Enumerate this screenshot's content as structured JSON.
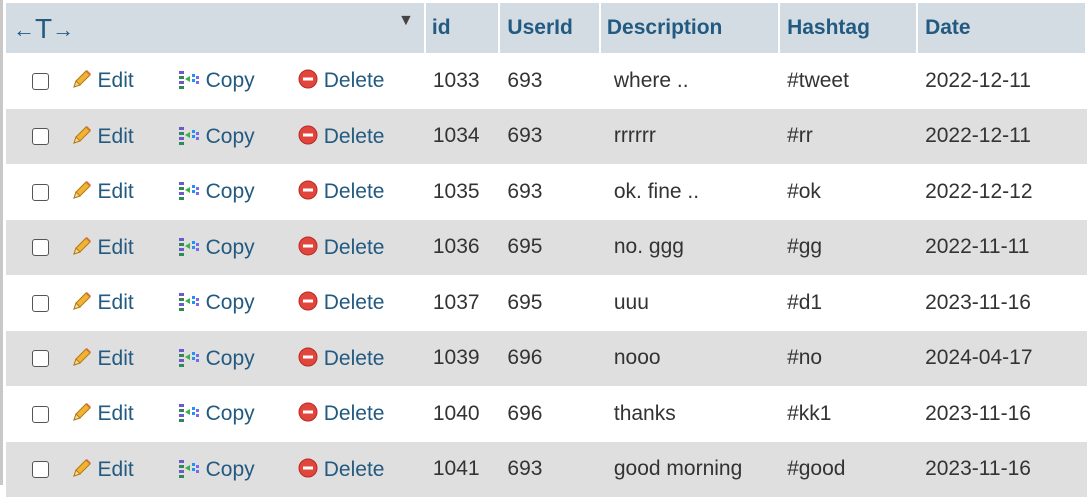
{
  "header": {
    "nav_left": "←",
    "nav_bar": "T",
    "nav_right": "→",
    "sort_indicator": "▼",
    "columns": [
      "id",
      "UserId",
      "Description",
      "Hashtag",
      "Date"
    ]
  },
  "actions": {
    "edit": "Edit",
    "copy": "Copy",
    "delete": "Delete"
  },
  "rows": [
    {
      "id": "1033",
      "userid": "693",
      "description": "where ..",
      "hashtag": "#tweet",
      "date": "2022-12-11"
    },
    {
      "id": "1034",
      "userid": "693",
      "description": "rrrrrr",
      "hashtag": "#rr",
      "date": "2022-12-11"
    },
    {
      "id": "1035",
      "userid": "693",
      "description": "ok. fine ..",
      "hashtag": "#ok",
      "date": "2022-12-12"
    },
    {
      "id": "1036",
      "userid": "695",
      "description": "no. ggg",
      "hashtag": "#gg",
      "date": "2022-11-11"
    },
    {
      "id": "1037",
      "userid": "695",
      "description": "uuu",
      "hashtag": "#d1",
      "date": "2023-11-16"
    },
    {
      "id": "1039",
      "userid": "696",
      "description": "nooo",
      "hashtag": "#no",
      "date": "2024-04-17"
    },
    {
      "id": "1040",
      "userid": "696",
      "description": "thanks",
      "hashtag": "#kk1",
      "date": "2023-11-16"
    },
    {
      "id": "1041",
      "userid": "693",
      "description": "good morning",
      "hashtag": "#good",
      "date": "2023-11-16"
    }
  ],
  "colors": {
    "header_bg": "#d3dce3",
    "header_text": "#235a81",
    "even_row_bg": "#dfdfdf",
    "link": "#235a81",
    "delete_icon": "#e2453c",
    "edit_icon": "#f2b233"
  },
  "icons": {
    "edit": "pencil-icon",
    "copy": "copy-insert-icon",
    "delete": "delete-circle-icon"
  }
}
